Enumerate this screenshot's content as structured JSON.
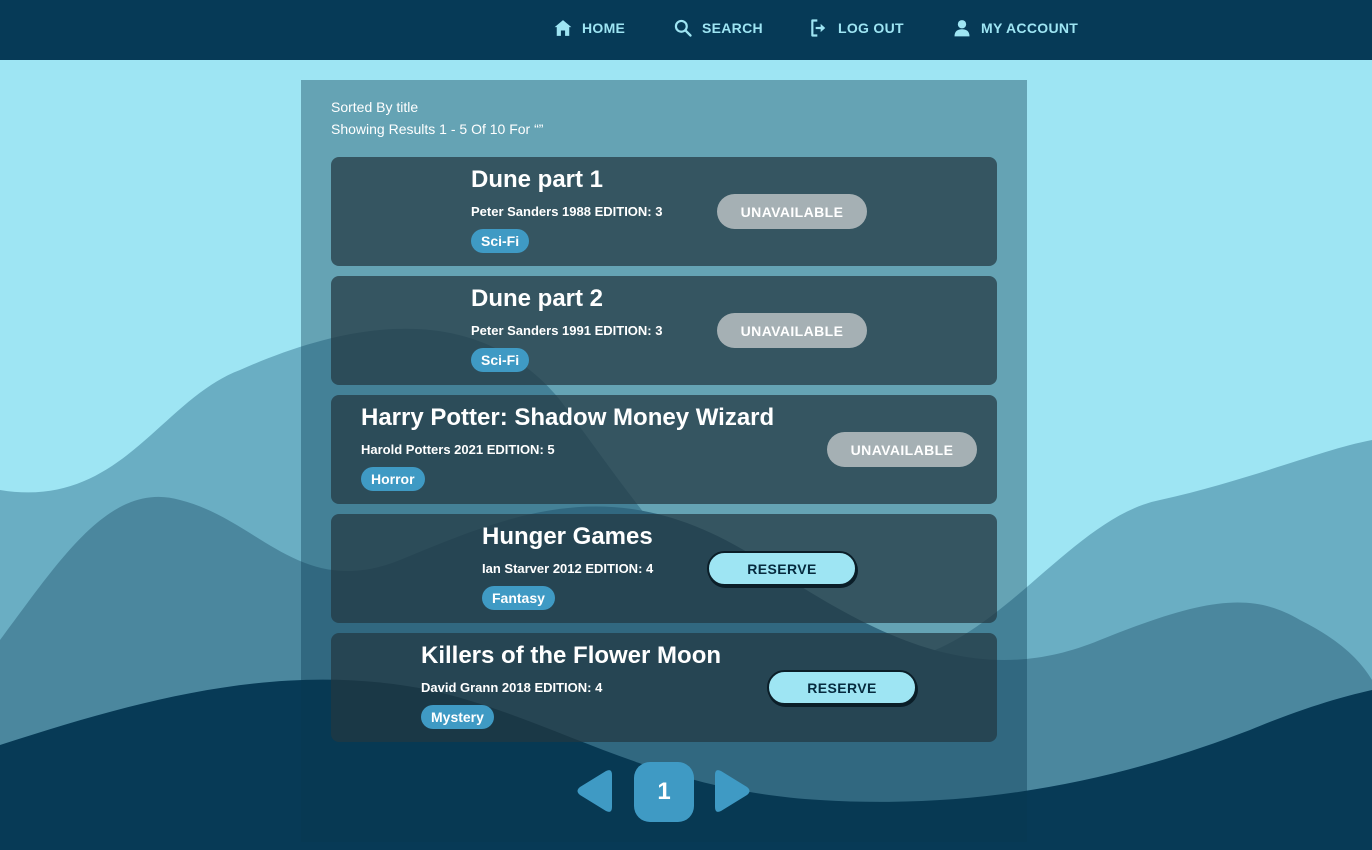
{
  "nav": {
    "items": [
      {
        "label": "HOME",
        "icon": "home-icon"
      },
      {
        "label": "SEARCH",
        "icon": "search-icon"
      },
      {
        "label": "LOG OUT",
        "icon": "logout-icon"
      },
      {
        "label": "MY ACCOUNT",
        "icon": "user-icon"
      }
    ]
  },
  "results": {
    "sort_text": "Sorted By title",
    "summary_text": "Showing Results 1 - 5 Of 10 For “”"
  },
  "books": [
    {
      "title": "Dune part 1",
      "meta": "Peter Sanders 1988 EDITION: 3",
      "genre": "Sci-Fi",
      "action": "UNAVAILABLE",
      "available": false
    },
    {
      "title": "Dune part 2",
      "meta": "Peter Sanders 1991 EDITION: 3",
      "genre": "Sci-Fi",
      "action": "UNAVAILABLE",
      "available": false
    },
    {
      "title": "Harry Potter: Shadow Money Wizard",
      "meta": "Harold Potters 2021 EDITION: 5",
      "genre": "Horror",
      "action": "UNAVAILABLE",
      "available": false
    },
    {
      "title": "Hunger Games",
      "meta": "Ian Starver 2012 EDITION: 4",
      "genre": "Fantasy",
      "action": "RESERVE",
      "available": true
    },
    {
      "title": "Killers of the Flower Moon",
      "meta": "David Grann 2018 EDITION: 4",
      "genre": "Mystery",
      "action": "RESERVE",
      "available": true
    }
  ],
  "pagination": {
    "current_page": "1"
  },
  "colors": {
    "nav_bg": "#063a57",
    "sky": "#9ee5f3",
    "accent": "#3f9ac4",
    "unavailable": "#a5b0b4"
  }
}
